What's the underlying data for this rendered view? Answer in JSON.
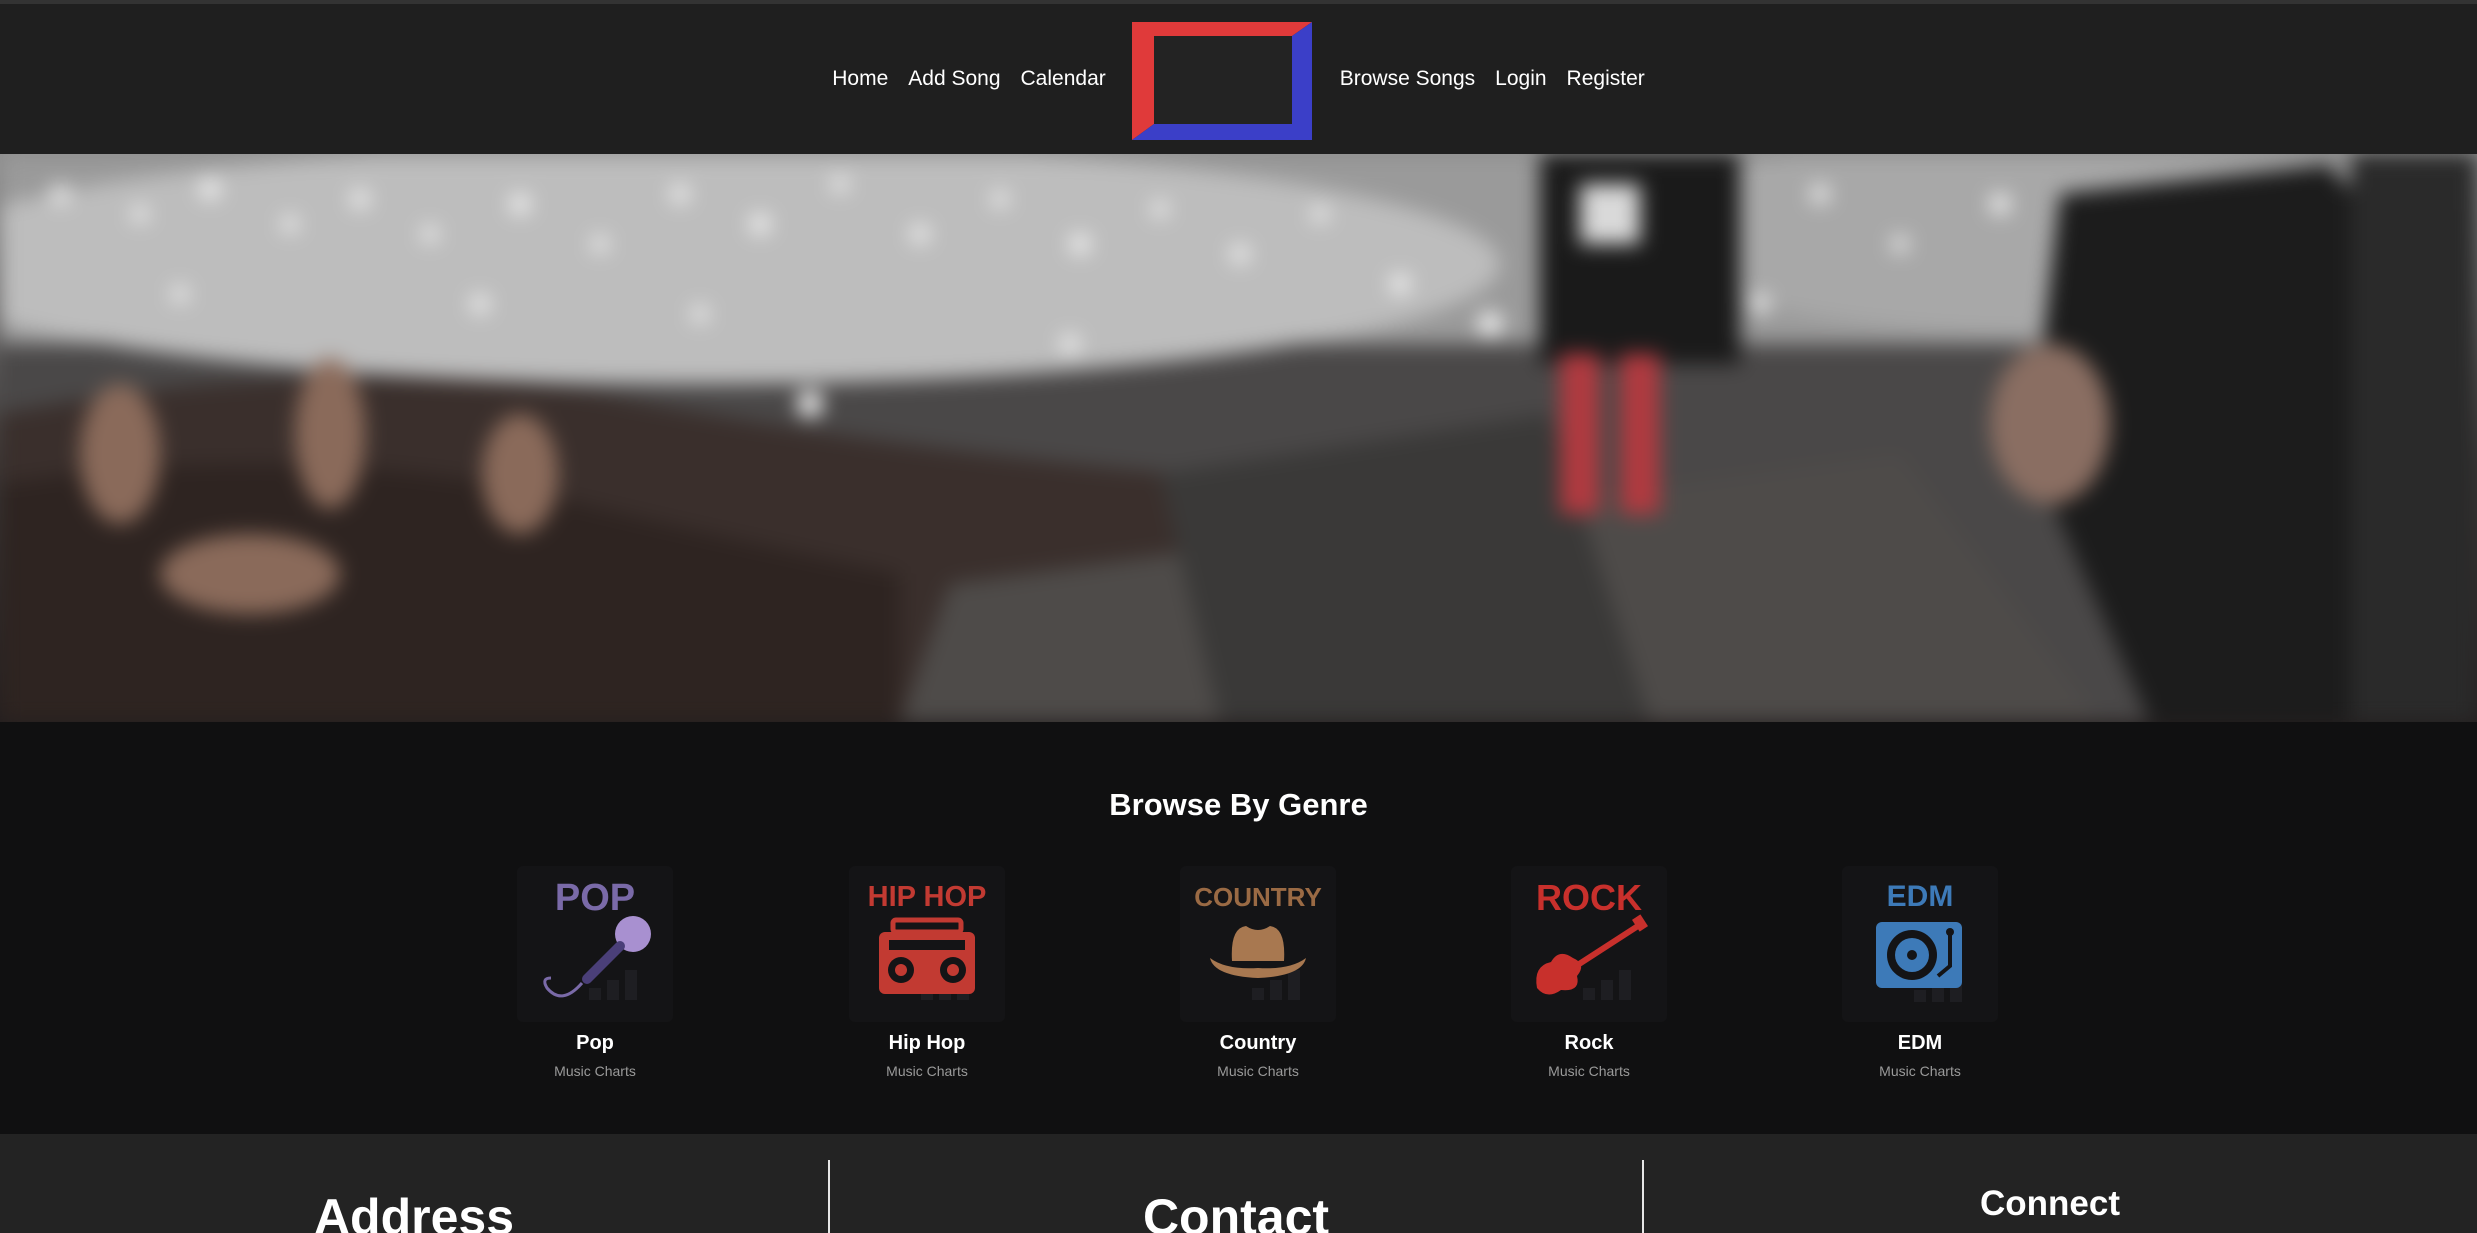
{
  "nav": {
    "left": [
      "Home",
      "Add Song",
      "Calendar"
    ],
    "right": [
      "Browse Songs",
      "Login",
      "Register"
    ],
    "logo_colors": {
      "red": "#e03a3a",
      "blue": "#3b3fc8"
    }
  },
  "genres": {
    "title": "Browse By Genre",
    "items": [
      {
        "tile_label": "POP",
        "name": "Pop",
        "subtitle": "Music Charts",
        "icon": "microphone-icon",
        "color": "#7a6aa8"
      },
      {
        "tile_label": "HIP HOP",
        "name": "Hip Hop",
        "subtitle": "Music Charts",
        "icon": "boombox-icon",
        "color": "#c23a32"
      },
      {
        "tile_label": "COUNTRY",
        "name": "Country",
        "subtitle": "Music Charts",
        "icon": "cowboy-hat-icon",
        "color": "#9a6a44"
      },
      {
        "tile_label": "ROCK",
        "name": "Rock",
        "subtitle": "Music Charts",
        "icon": "electric-guitar-icon",
        "color": "#c8302c"
      },
      {
        "tile_label": "EDM",
        "name": "EDM",
        "subtitle": "Music Charts",
        "icon": "turntable-icon",
        "color": "#3d7ab8"
      }
    ]
  },
  "footer": {
    "address": "Address",
    "contact": "Contact",
    "connect": "Connect"
  }
}
